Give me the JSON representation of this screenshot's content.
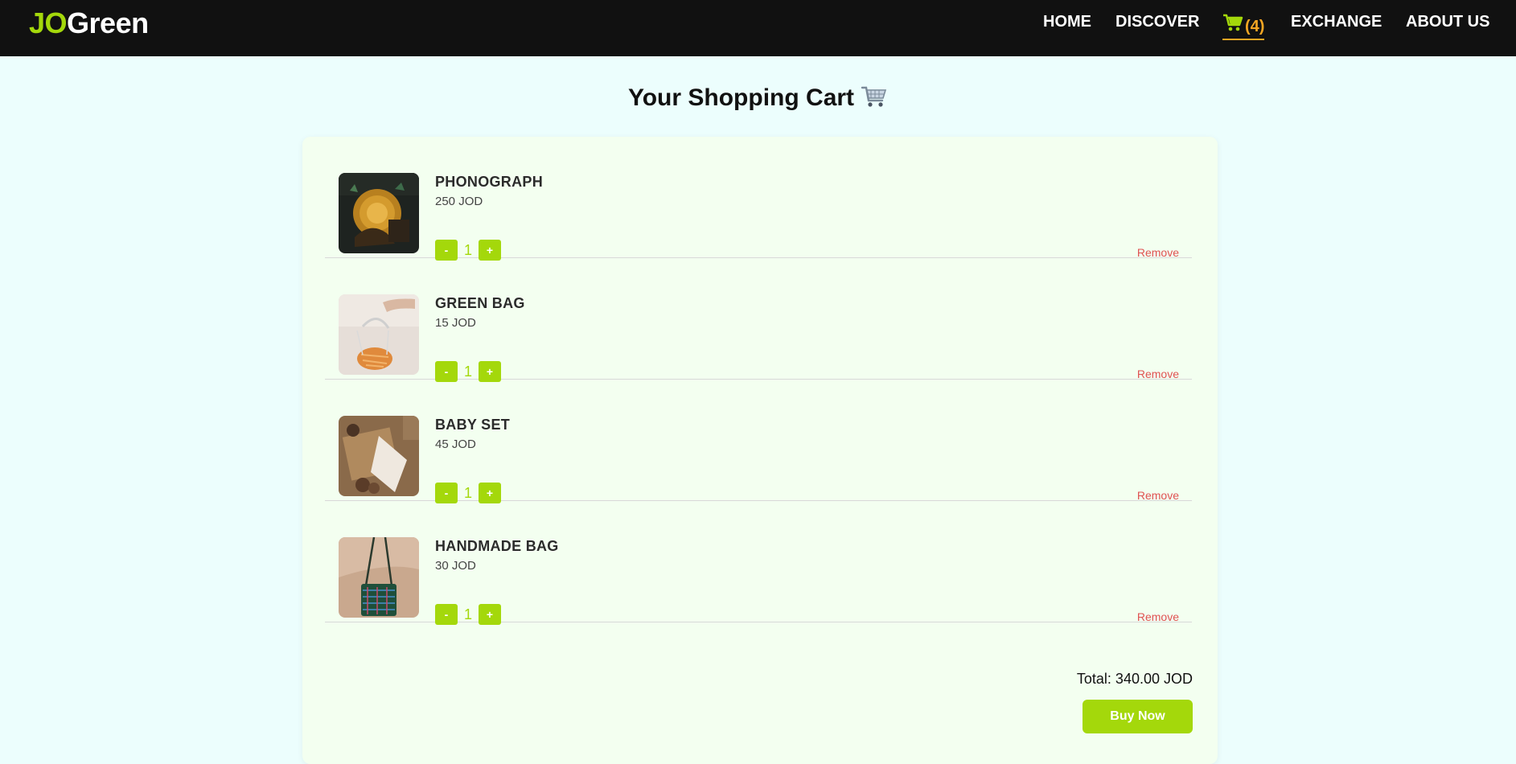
{
  "header": {
    "logo_part1": "JO",
    "logo_part2": "Green",
    "nav": {
      "home": "HOME",
      "discover": "DISCOVER",
      "cart_count": "(4)",
      "exchange": "EXCHANGE",
      "about": "ABOUT US"
    }
  },
  "title": "Your Shopping Cart",
  "cart": {
    "items": [
      {
        "name": "PHONOGRAPH",
        "price": "250 JOD",
        "quantity": "1",
        "minus_label": "-",
        "plus_label": "+",
        "remove_label": "Remove"
      },
      {
        "name": "GREEN BAG",
        "price": "15 JOD",
        "quantity": "1",
        "minus_label": "-",
        "plus_label": "+",
        "remove_label": "Remove"
      },
      {
        "name": "BABY SET",
        "price": "45 JOD",
        "quantity": "1",
        "minus_label": "-",
        "plus_label": "+",
        "remove_label": "Remove"
      },
      {
        "name": "HANDMADE BAG",
        "price": "30 JOD",
        "quantity": "1",
        "minus_label": "-",
        "plus_label": "+",
        "remove_label": "Remove"
      }
    ],
    "total": "Total: 340.00 JOD",
    "buy_label": "Buy Now"
  },
  "colors": {
    "accent": "#a4d80b",
    "header_bg": "#111111",
    "cart_active": "#f5a623",
    "remove": "#e05252",
    "page_bg": "#ecfefd",
    "panel_bg": "#f3fff0"
  },
  "icons": {
    "nav_cart": "shopping-cart-icon",
    "title_cart": "shopping-cart-emoji"
  }
}
